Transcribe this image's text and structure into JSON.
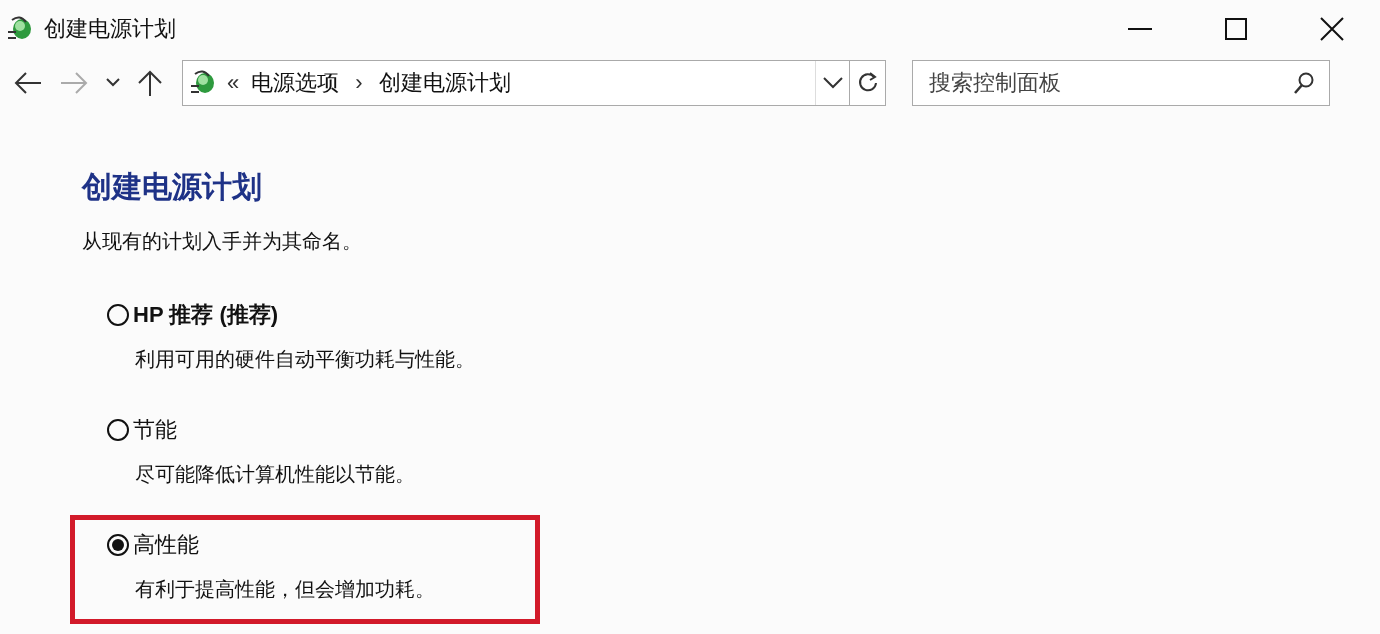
{
  "window": {
    "title": "创建电源计划"
  },
  "address_bar": {
    "prefix": "«",
    "crumbs": [
      "电源选项",
      "创建电源计划"
    ],
    "separator": "›"
  },
  "search": {
    "placeholder": "搜索控制面板"
  },
  "heading": "创建电源计划",
  "instruction": "从现有的计划入手并为其命名。",
  "plans": [
    {
      "label": "HP 推荐 (推荐)",
      "description": "利用可用的硬件自动平衡功耗与性能。",
      "selected": false,
      "bold": true,
      "highlighted": false
    },
    {
      "label": "节能",
      "description": "尽可能降低计算机性能以节能。",
      "selected": false,
      "bold": false,
      "highlighted": false
    },
    {
      "label": "高性能",
      "description": "有利于提高性能，但会增加功耗。",
      "selected": true,
      "bold": false,
      "highlighted": true
    }
  ]
}
